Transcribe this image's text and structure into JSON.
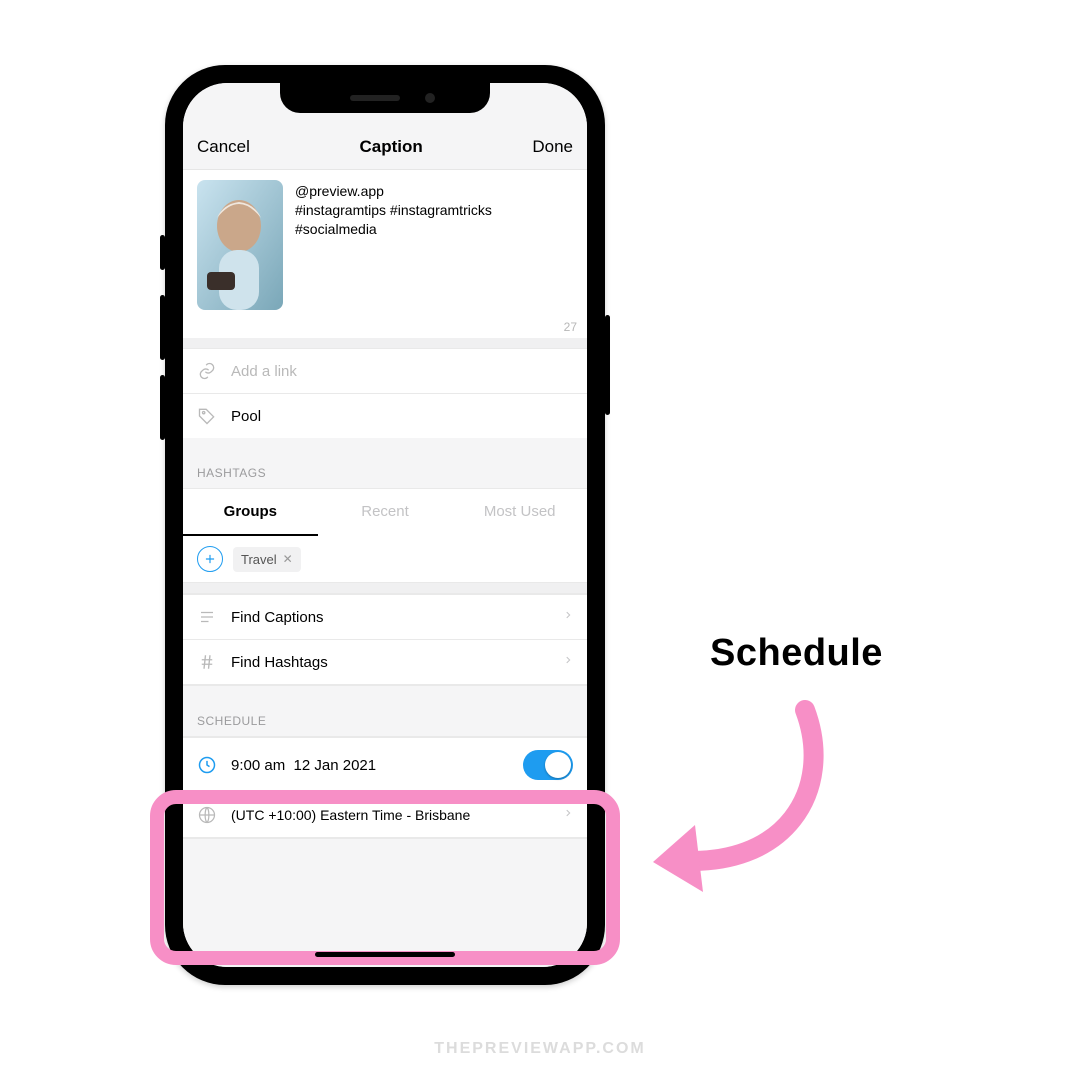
{
  "navbar": {
    "cancel": "Cancel",
    "title": "Caption",
    "done": "Done"
  },
  "caption": {
    "text": "@preview.app\n#instagramtips #instagramtricks\n#socialmedia",
    "char_count": "27"
  },
  "link_row": {
    "placeholder": "Add a link"
  },
  "location_row": {
    "value": "Pool"
  },
  "hashtags": {
    "header": "HASHTAGS",
    "tabs": {
      "groups": "Groups",
      "recent": "Recent",
      "most_used": "Most Used"
    },
    "chip": "Travel"
  },
  "finders": {
    "captions": "Find Captions",
    "hashtags": "Find Hashtags"
  },
  "schedule": {
    "header": "SCHEDULE",
    "time": "9:00 am",
    "date": "12 Jan 2021",
    "timezone": "(UTC +10:00) Eastern Time - Brisbane"
  },
  "annotation": "Schedule",
  "watermark": "THEPREVIEWAPP.COM",
  "colors": {
    "accent": "#1e9cf0",
    "highlight": "#f78fc6"
  }
}
